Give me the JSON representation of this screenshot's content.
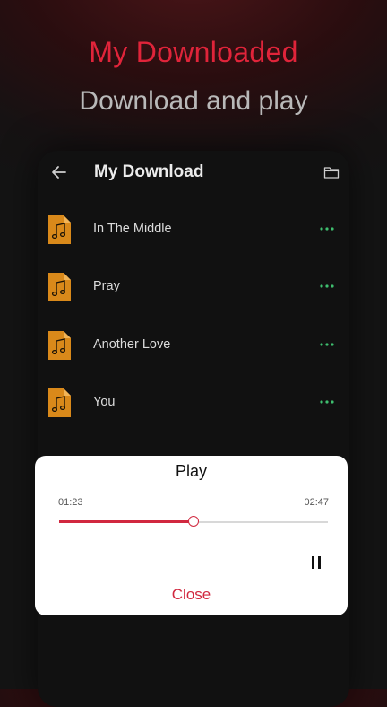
{
  "promo": {
    "title": "My Downloaded",
    "subtitle": "Download and play"
  },
  "header": {
    "title": "My Download",
    "back_icon": "arrow-left-icon",
    "folder_icon": "folder-icon"
  },
  "tracks": [
    {
      "title": "In The Middle"
    },
    {
      "title": "Pray"
    },
    {
      "title": "Another Love"
    },
    {
      "title": "You"
    }
  ],
  "player": {
    "title": "Play",
    "elapsed": "01:23",
    "total": "02:47",
    "progress": 0.5,
    "pause_icon": "pause-icon",
    "close_label": "Close"
  },
  "colors": {
    "accent": "#d1283f",
    "promo_title": "#e0243a",
    "file_icon": "#d9891a",
    "more_dots": "#3fbf6f",
    "phone_bg": "#111111"
  }
}
